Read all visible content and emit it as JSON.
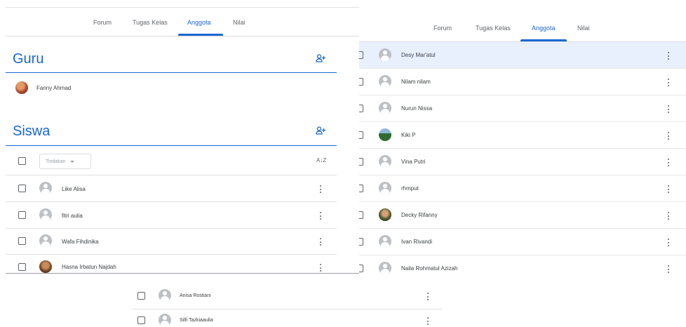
{
  "colors": {
    "accent": "#1967d2",
    "highlight_row": "#e8f0fe"
  },
  "tabs": [
    "Forum",
    "Tugas Kelas",
    "Anggota",
    "Nilai"
  ],
  "active_tab": "Anggota",
  "left": {
    "guru_title": "Guru",
    "teacher": {
      "name": "Fanny Ahmad",
      "avatar": "photo-avatar"
    },
    "siswa_title": "Siswa",
    "actions_dropdown": "Tindakan",
    "sort_icon": "A↓Z",
    "students": [
      "Like Alisa",
      "fitri aulia",
      "Wafa Fihdinika",
      "Hasna Irbatun Najdah"
    ]
  },
  "right": {
    "students": [
      "Desy Mar'atul",
      "Nilam nilam",
      "Nurun Nissa",
      "Kiki P",
      "Vina Putri",
      "rhmput",
      "Decky Rifanny",
      "Ivan Rivandi",
      "Naila Rohmatul Azizah"
    ]
  },
  "bottom": {
    "students": [
      "Anisa Rostiani",
      "Silfi Tazkiaaulia"
    ]
  },
  "icons": {
    "add_person": "add-person-icon",
    "more": "more-vert-icon",
    "checkbox": "checkbox-icon",
    "avatar": "avatar-icon"
  }
}
